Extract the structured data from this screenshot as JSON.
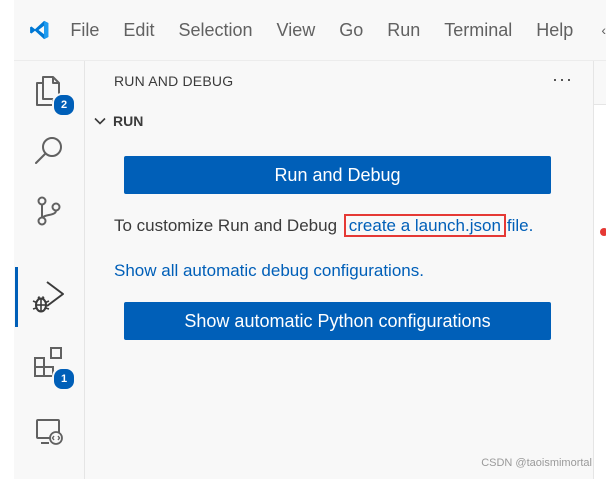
{
  "menubar": {
    "items": [
      "File",
      "Edit",
      "Selection",
      "View",
      "Go",
      "Run",
      "Terminal",
      "Help"
    ]
  },
  "activity_bar": {
    "explorer_badge": "2",
    "extensions_badge": "1"
  },
  "sidebar": {
    "title": "RUN AND DEBUG",
    "more_label": "···",
    "section": "RUN",
    "run_debug_button": "Run and Debug",
    "customize_prefix": "To customize Run and Debug ",
    "launch_link": "create a launch.json",
    "customize_suffix": "file.",
    "show_all_link": "Show all automatic debug configurations.",
    "python_button": "Show automatic Python configurations"
  },
  "colors": {
    "accent": "#005fb8",
    "highlight_box": "#e53935"
  },
  "watermark": "CSDN @taoismimortal"
}
